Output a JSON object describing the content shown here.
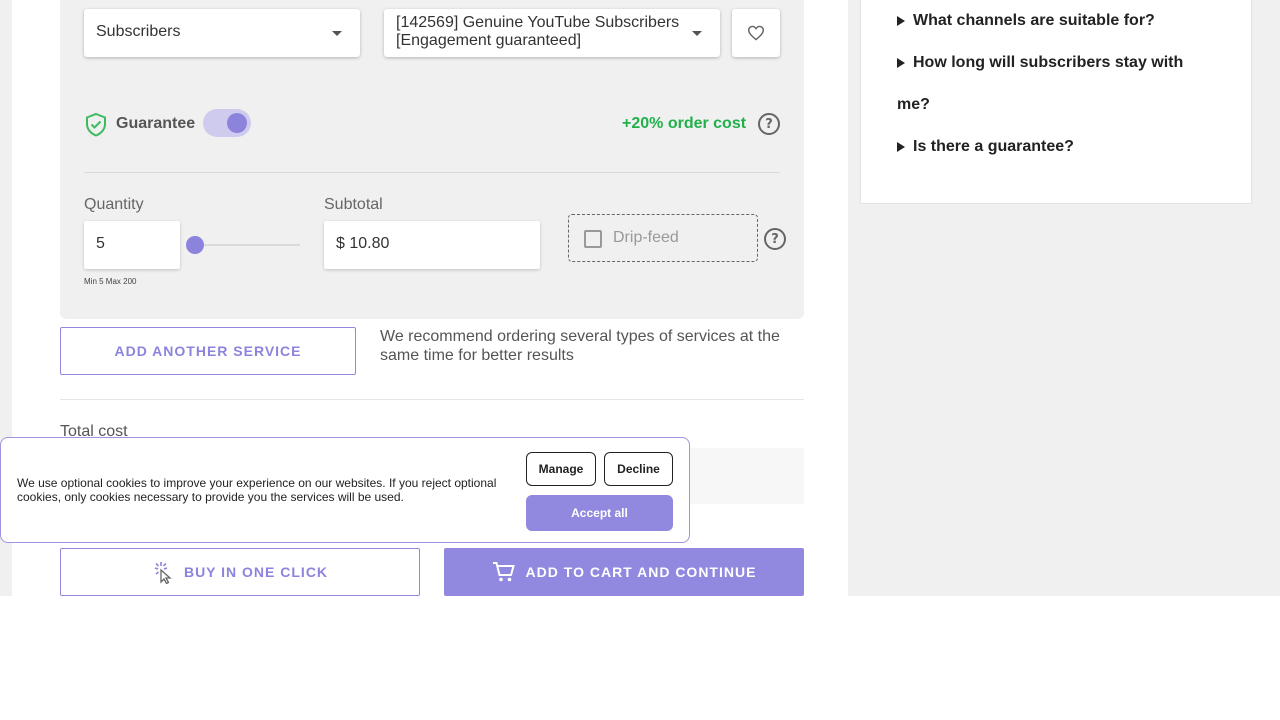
{
  "order": {
    "type_select": {
      "value": "Subscribers"
    },
    "service_select": {
      "value": "[142569] Genuine YouTube Subscribers [Engagement guaranteed]"
    },
    "guarantee": {
      "label": "Guarantee",
      "enabled": true,
      "extra_cost": "+20% order cost"
    },
    "quantity": {
      "label": "Quantity",
      "value": "5",
      "minmax": "Min 5 Max 200",
      "slider_fraction": 0.0
    },
    "subtotal": {
      "label": "Subtotal",
      "value": "$ 10.80"
    },
    "drip_feed": {
      "label": "Drip-feed",
      "checked": false
    }
  },
  "add_service": {
    "button_label": "ADD ANOTHER SERVICE",
    "recommendation": "We recommend ordering several types of services at the same time for better results"
  },
  "total": {
    "label": "Total cost"
  },
  "actions": {
    "buy_one_click": "BUY IN ONE CLICK",
    "add_to_cart": "ADD TO CART AND CONTINUE"
  },
  "faq": {
    "items": [
      "What channels are suitable for?",
      "How long will subscribers stay with me?",
      "Is there a guarantee?"
    ]
  },
  "cookie_banner": {
    "text": "We use optional cookies to improve your experience on our websites. If you reject optional cookies, only cookies necessary to provide you the services will be used.",
    "manage": "Manage",
    "decline": "Decline",
    "accept": "Accept all"
  },
  "colors": {
    "accent": "#9089df",
    "success": "#22b04b"
  }
}
